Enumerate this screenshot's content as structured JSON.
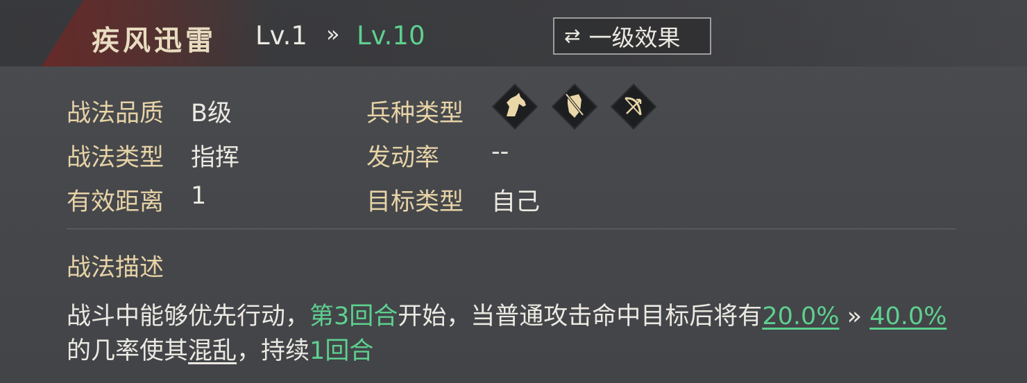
{
  "header": {
    "title": "疾风迅雷",
    "level_from": "Lv.1",
    "arrow": "»",
    "level_to": "Lv.10",
    "toggle_button": {
      "icon": "swap-arrows-icon",
      "label": "一级效果"
    }
  },
  "attributes": {
    "quality": {
      "label": "战法品质",
      "value": "B级"
    },
    "type": {
      "label": "战法类型",
      "value": "指挥"
    },
    "range": {
      "label": "有效距离",
      "value": "1"
    },
    "troop_type": {
      "label": "兵种类型",
      "icons": [
        "cavalry-horse-icon",
        "shield-infantry-icon",
        "bow-archer-icon"
      ]
    },
    "trigger_rate": {
      "label": "发动率",
      "value": "--"
    },
    "target_type": {
      "label": "目标类型",
      "value": "自己"
    }
  },
  "description": {
    "title": "战法描述",
    "seg1": "战斗中能够优先行动，",
    "seg2": "第3回合",
    "seg3": "开始，当普通攻击命中目标后将有",
    "seg4": "20.0%",
    "seg5": " » ",
    "seg6": "40.0%",
    "seg7": "的几率使其",
    "seg8": "混乱",
    "seg9": "，持续",
    "seg10": "1回合"
  },
  "colors": {
    "accent_green": "#5ed08f",
    "label_gold": "#e7d3a6",
    "icon_gold": "#e9d7a8"
  }
}
